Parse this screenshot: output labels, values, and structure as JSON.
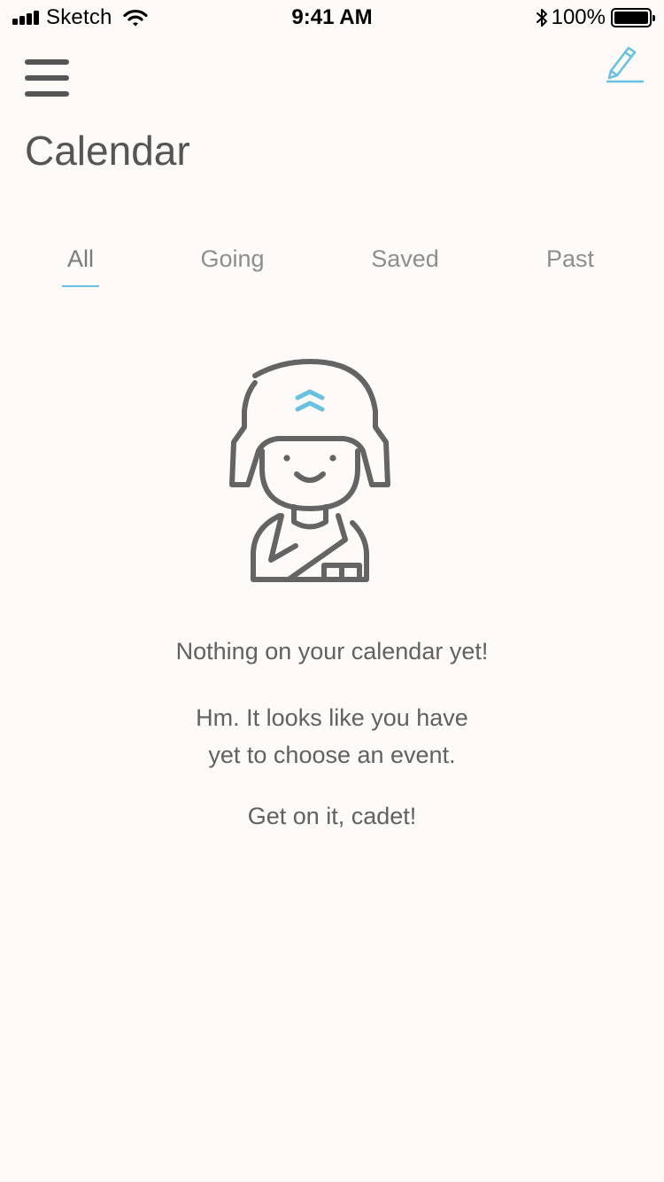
{
  "status_bar": {
    "carrier": "Sketch",
    "time": "9:41 AM",
    "battery_percent": "100%",
    "signal_bars": 4,
    "battery_level": 1.0,
    "icons": [
      "signal-icon",
      "wifi-icon",
      "bluetooth-icon",
      "battery-icon"
    ]
  },
  "header": {
    "menu_icon": "hamburger-menu-icon",
    "edit_icon": "pencil-edit-icon",
    "title": "Calendar"
  },
  "tabs": [
    {
      "label": "All",
      "active": true
    },
    {
      "label": "Going",
      "active": false
    },
    {
      "label": "Saved",
      "active": false
    },
    {
      "label": "Past",
      "active": false
    }
  ],
  "empty_state": {
    "illustration": "cadet-soldier-icon",
    "title": "Nothing on your calendar yet!",
    "body_line1": "Hm. It looks like you have",
    "body_line2": "yet to choose an event.",
    "cta": "Get on it, cadet!"
  },
  "colors": {
    "background": "#fdfaf8",
    "accent": "#66c2e0",
    "text": "#616161",
    "tab_inactive": "#8e8e8e"
  }
}
